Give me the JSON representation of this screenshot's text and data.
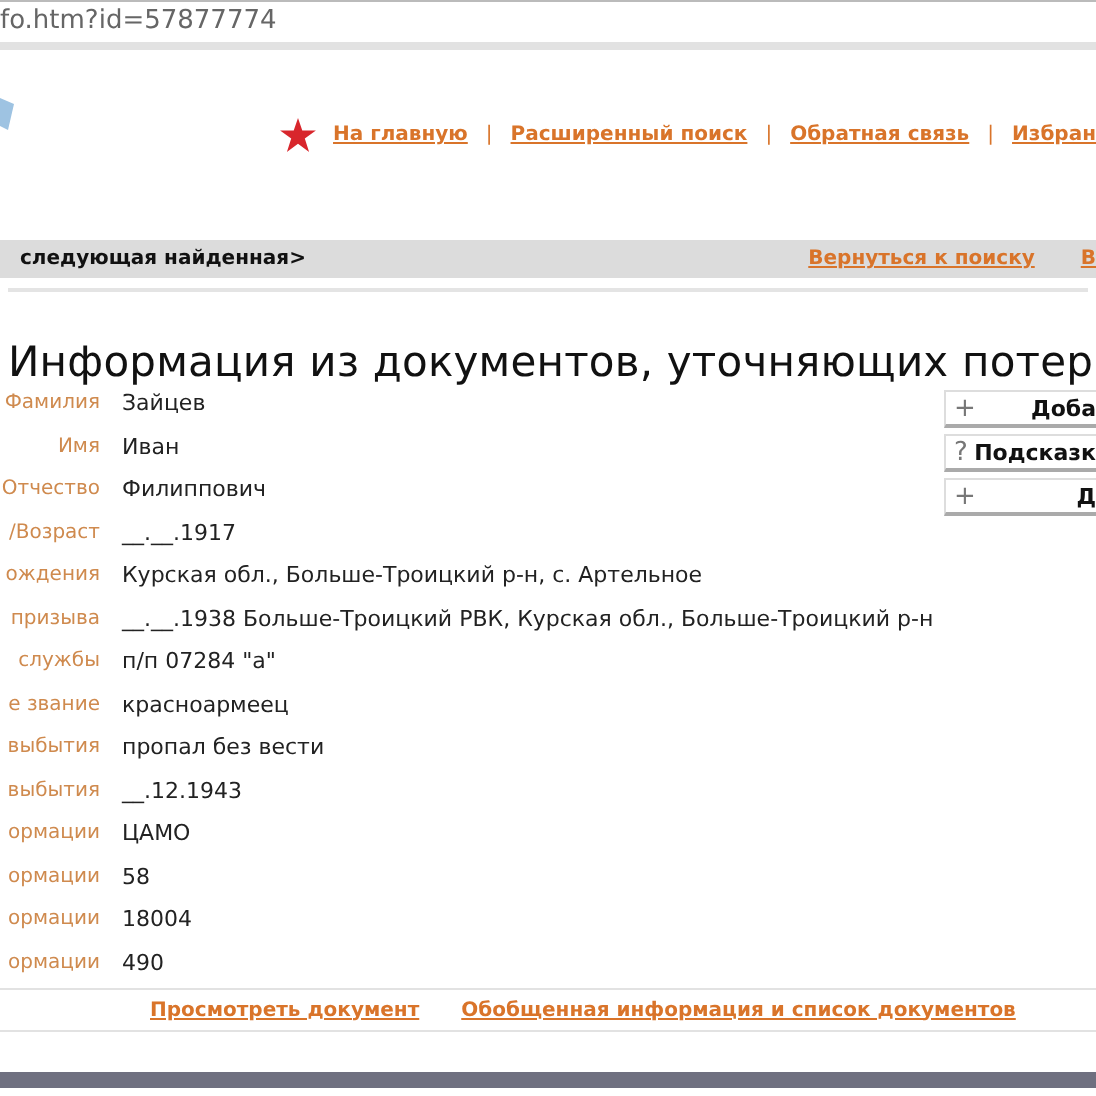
{
  "address_bar": {
    "url": "fo.htm?id=57877774"
  },
  "header_nav": [
    {
      "kind": "star"
    },
    {
      "kind": "link",
      "label": "На главную"
    },
    {
      "kind": "separator",
      "label": "|"
    },
    {
      "kind": "link",
      "label": "Расширенный поиск"
    },
    {
      "kind": "separator",
      "label": "|"
    },
    {
      "kind": "link",
      "label": "Обратная связь"
    },
    {
      "kind": "separator",
      "label": "|"
    },
    {
      "kind": "link",
      "label": "Избран"
    }
  ],
  "result_bar": {
    "next": "следующая найденная>",
    "links": [
      "Вернуться к поиску",
      "В"
    ]
  },
  "title": "Информация из документов, уточняющих потер",
  "fields": [
    {
      "label": "Фамилия",
      "value": "Зайцев"
    },
    {
      "label": "Имя",
      "value": "Иван"
    },
    {
      "label": "Отчество",
      "value": "Филиппович"
    },
    {
      "label": "/Возраст",
      "value": "__.__.1917"
    },
    {
      "label": "ождения",
      "value": "Курская обл., Больше-Троицкий р-н, с. Артельное"
    },
    {
      "label": "призыва",
      "value": "__.__.1938 Больше-Троицкий РВК, Курская обл., Больше-Троицкий р-н"
    },
    {
      "label": "службы",
      "value": "п/п 07284 \"а\""
    },
    {
      "label": "е звание",
      "value": "красноармеец"
    },
    {
      "label": "выбытия",
      "value": "пропал без вести"
    },
    {
      "label": "выбытия",
      "value": "__.12.1943"
    },
    {
      "label": "ормации",
      "value": "ЦАМО"
    },
    {
      "label": "ормации",
      "value": "58"
    },
    {
      "label": "ормации",
      "value": "18004"
    },
    {
      "label": "ормации",
      "value": "490"
    }
  ],
  "side_buttons": [
    {
      "icon": "+",
      "label": "Доба"
    },
    {
      "icon": "?",
      "label": "Подсказк"
    },
    {
      "icon": "+",
      "label": "Д"
    }
  ],
  "footer_links": [
    "Просмотреть документ",
    "Обобщенная информация и список документов"
  ]
}
